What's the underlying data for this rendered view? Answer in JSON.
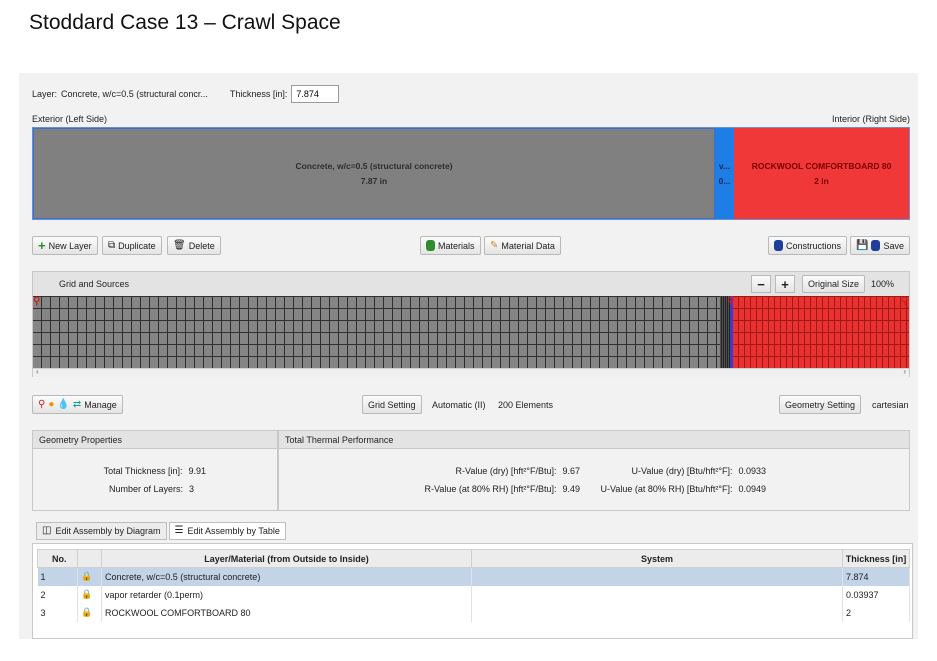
{
  "slide_title": "Stoddard Case 13 – Crawl Space",
  "top": {
    "layer_label": "Layer:",
    "layer_value": "Concrete, w/c=0.5 (structural concr...",
    "thickness_label": "Thickness [in]:",
    "thickness_value": "7.874",
    "exterior_label": "Exterior (Left Side)",
    "interior_label": "Interior (Right Side)"
  },
  "layers": [
    {
      "name": "Concrete, w/c=0.5 (structural concrete)",
      "thickness": "7.87 in",
      "color": "#808080"
    },
    {
      "name": "v...",
      "thickness": "0...",
      "color": "#1e7ee6"
    },
    {
      "name": "ROCKWOOL COMFORTBOARD 80",
      "thickness": "2 in",
      "color": "#f03838"
    }
  ],
  "toolbar": {
    "new_layer": "New Layer",
    "duplicate": "Duplicate",
    "delete": "Delete",
    "materials": "Materials",
    "material_data": "Material Data",
    "constructions": "Constructions",
    "save": "Save"
  },
  "grid": {
    "title": "Grid and Sources",
    "minus": "−",
    "plus": "+",
    "original_size": "Original Size",
    "zoom": "100%"
  },
  "sources": {
    "manage": "Manage",
    "grid_setting": "Grid Setting",
    "grid_mode": "Automatic (II)",
    "elements": "200 Elements",
    "geometry_setting": "Geometry Setting",
    "geometry_type": "cartesian"
  },
  "geometry": {
    "title": "Geometry Properties",
    "total_thickness_label": "Total Thickness [in]:",
    "total_thickness_value": "9.91",
    "num_layers_label": "Number of Layers:",
    "num_layers_value": "3"
  },
  "thermal": {
    "title": "Total Thermal Performance",
    "r_dry_label": "R-Value (dry) [hft²°F/Btu]:",
    "r_dry_value": "9.67",
    "r_rh_label": "R-Value (at 80% RH) [hft²°F/Btu]:",
    "r_rh_value": "9.49",
    "u_dry_label": "U-Value (dry) [Btu/hft²°F]:",
    "u_dry_value": "0.0933",
    "u_rh_label": "U-Value (at 80% RH) [Btu/hft²°F]:",
    "u_rh_value": "0.0949"
  },
  "tabs": {
    "diagram": "Edit Assembly by Diagram",
    "table": "Edit Assembly by Table"
  },
  "table": {
    "headers": [
      "No.",
      "",
      "Layer/Material (from Outside to Inside)",
      "System",
      "Thickness [in]"
    ],
    "rows": [
      {
        "no": "1",
        "material": "Concrete, w/c=0.5 (structural concrete)",
        "system": "",
        "thickness": "7.874"
      },
      {
        "no": "2",
        "material": "vapor retarder (0.1perm)",
        "system": "",
        "thickness": "0.03937"
      },
      {
        "no": "3",
        "material": "ROCKWOOL COMFORTBOARD 80",
        "system": "",
        "thickness": "2"
      }
    ]
  }
}
